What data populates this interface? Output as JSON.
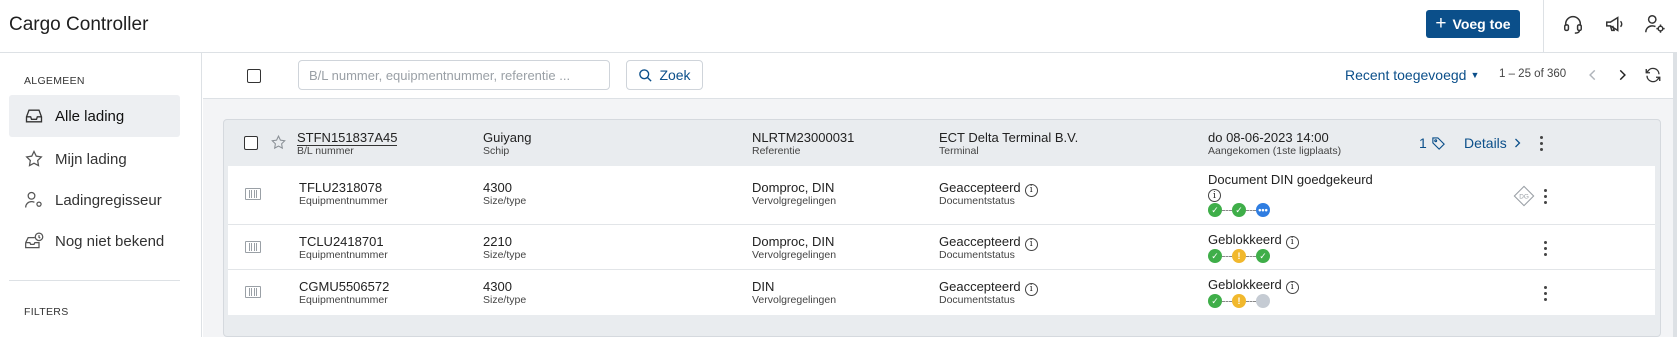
{
  "header": {
    "app_title": "Cargo Controller",
    "add_button": {
      "icon": "plus-icon",
      "label": "Voeg toe"
    },
    "icons": [
      "headset-icon",
      "megaphone-icon",
      "user-settings-icon"
    ],
    "accent_color": "#0b4f8a"
  },
  "sidebar": {
    "section_general": "ALGEMEEN",
    "items": [
      {
        "label": "Alle lading",
        "icon": "inbox-icon",
        "active": true
      },
      {
        "label": "Mijn lading",
        "icon": "star-icon",
        "active": false
      },
      {
        "label": "Ladingregisseur",
        "icon": "user-settings-icon",
        "active": false
      },
      {
        "label": "Nog niet bekend",
        "icon": "inbox-clock-icon",
        "active": false
      }
    ],
    "section_filters": "FILTERS"
  },
  "toolbar": {
    "search_placeholder": "B/L nummer, equipmentnummer, referentie ...",
    "search_value": "",
    "search_button": "Zoek",
    "sort_label": "Recent toegevoegd",
    "pagination": "1 – 25 of 360"
  },
  "shipment": {
    "bl_number": "STFN151837A45",
    "bl_label": "B/L nummer",
    "ship": "Guiyang",
    "ship_label": "Schip",
    "reference": "NLRTM23000031",
    "reference_label": "Referentie",
    "terminal": "ECT Delta Terminal B.V.",
    "terminal_label": "Terminal",
    "arrival": "do 08-06-2023 14:00",
    "arrival_label": "Aangekomen (1ste ligplaats)",
    "tag_count": "1",
    "details_label": "Details"
  },
  "containers": [
    {
      "number": "TFLU2318078",
      "number_label": "Equipmentnummer",
      "size_type": "4300",
      "size_type_label": "Size/type",
      "follow_up": "Domproc, DIN",
      "follow_up_label": "Vervolgregelingen",
      "doc_status": "Geaccepteerd",
      "doc_status_label": "Documentstatus",
      "status_title": "Document DIN goedgekeurd",
      "steps": [
        "green",
        "green",
        "blue"
      ],
      "dg_badge": "DG"
    },
    {
      "number": "TCLU2418701",
      "number_label": "Equipmentnummer",
      "size_type": "2210",
      "size_type_label": "Size/type",
      "follow_up": "Domproc, DIN",
      "follow_up_label": "Vervolgregelingen",
      "doc_status": "Geaccepteerd",
      "doc_status_label": "Documentstatus",
      "status_title": "Geblokkeerd",
      "steps": [
        "green",
        "yellow",
        "green"
      ]
    },
    {
      "number": "CGMU5506572",
      "number_label": "Equipmentnummer",
      "size_type": "4300",
      "size_type_label": "Size/type",
      "follow_up": "DIN",
      "follow_up_label": "Vervolgregelingen",
      "doc_status": "Geaccepteerd",
      "doc_status_label": "Documentstatus",
      "status_title": "Geblokkeerd",
      "steps": [
        "green",
        "yellow",
        "gray"
      ]
    }
  ],
  "status_colors": {
    "green": "#3fae49",
    "yellow": "#f1b82d",
    "blue": "#2f7de1",
    "gray": "#c5cbd3"
  }
}
